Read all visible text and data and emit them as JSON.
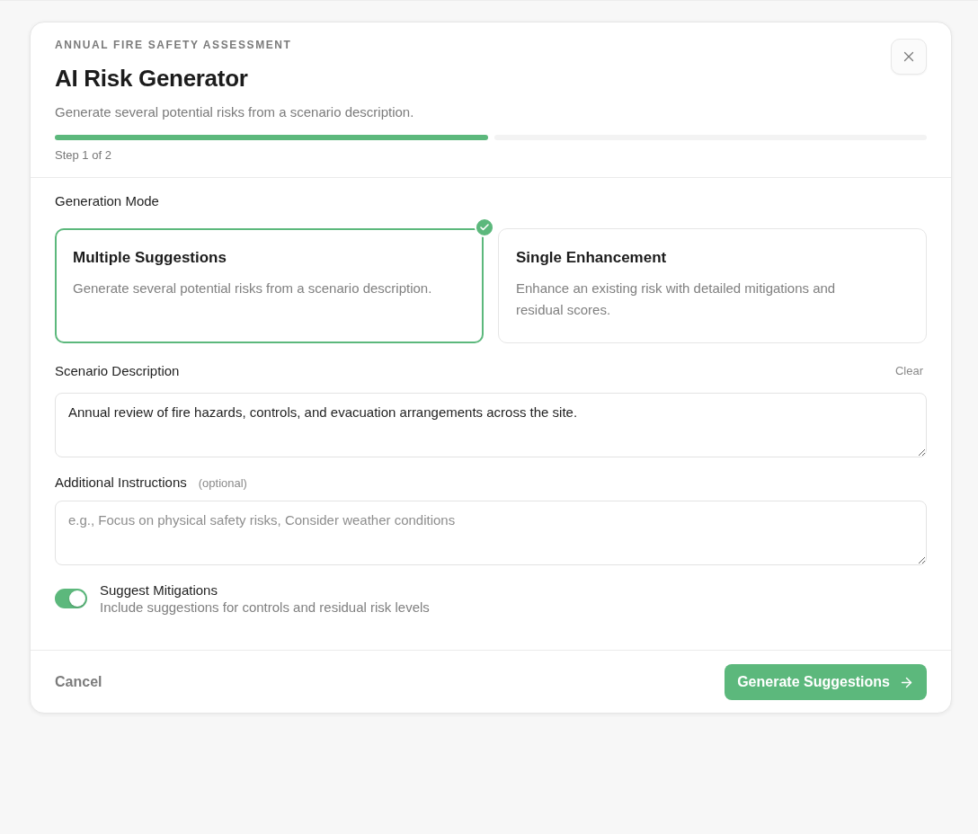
{
  "header": {
    "eyebrow": "ANNUAL FIRE SAFETY ASSESSMENT",
    "title": "AI Risk Generator",
    "subtitle": "Generate several potential risks from a scenario description.",
    "progress": {
      "segments": [
        {
          "filled": true
        },
        {
          "filled": false
        }
      ],
      "caption": "Step 1 of 2"
    }
  },
  "generation_mode": {
    "label": "Generation Mode",
    "options": [
      {
        "title": "Multiple Suggestions",
        "description": "Generate several potential risks from a scenario description.",
        "selected": true
      },
      {
        "title": "Single Enhancement",
        "description": "Enhance an existing risk with detailed mitigations and residual scores.",
        "selected": false
      }
    ]
  },
  "fields": [
    {
      "label": "Scenario Description",
      "action": "Clear",
      "value": "Annual review of fire hazards, controls, and evacuation arrangements across the site."
    },
    {
      "label": "Additional Instructions",
      "note": "(optional)",
      "placeholder": "e.g., Focus on physical safety risks, Consider weather conditions"
    }
  ],
  "toggle": {
    "label": "Suggest Mitigations",
    "description": "Include suggestions for controls and residual risk levels",
    "on": true
  },
  "footer": {
    "cancel": "Cancel",
    "submit": "Generate Suggestions"
  }
}
